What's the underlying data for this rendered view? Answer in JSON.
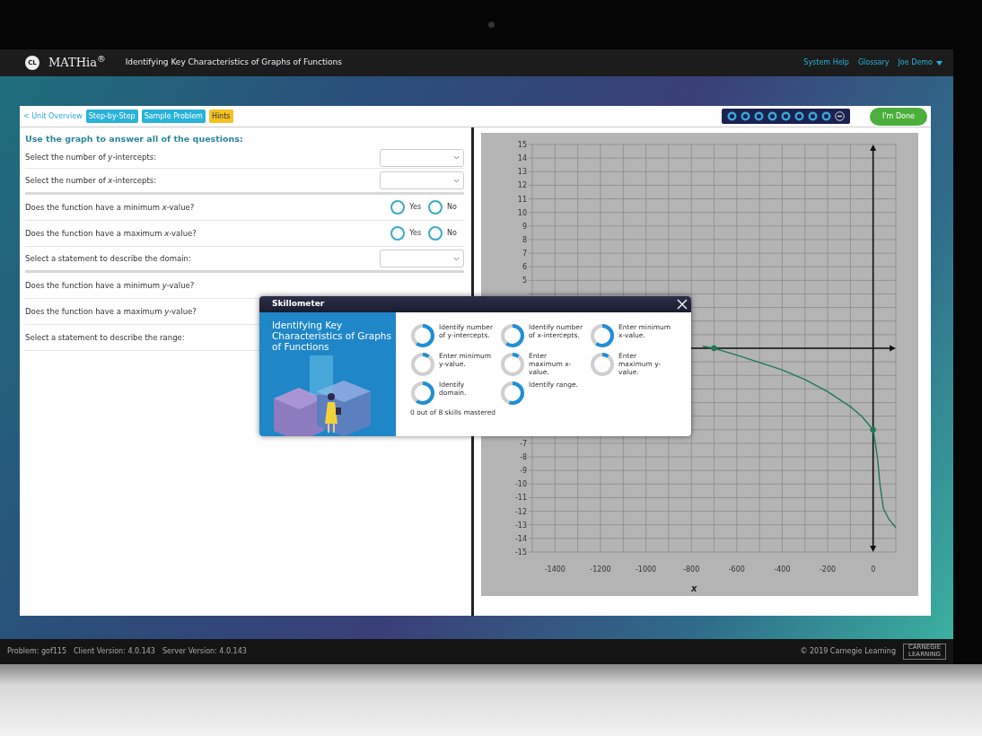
{
  "header": {
    "logo_mark": "CL",
    "app_name": "MATHia$^{®}$",
    "lesson_title": "Identifying Key Characteristics of Graphs of Functions",
    "links": [
      {
        "label": "System Help",
        "kind": "link"
      },
      {
        "label": "Glossary",
        "kind": "link"
      },
      {
        "label": "Joe Demo",
        "kind": "menu"
      }
    ]
  },
  "toolbar": {
    "back_link": "< Unit Overview",
    "tabs": [
      {
        "label": "Step-by-Step",
        "kind": "mode"
      },
      {
        "label": "Sample Problem",
        "kind": "mode"
      },
      {
        "label": "Hints",
        "kind": "hint"
      }
    ],
    "progress": [
      {
        "kind": "step"
      },
      {
        "kind": "step"
      },
      {
        "kind": "step"
      },
      {
        "kind": "step"
      },
      {
        "kind": "step"
      },
      {
        "kind": "step"
      },
      {
        "kind": "step"
      },
      {
        "kind": "step"
      },
      {
        "kind": "remove"
      }
    ],
    "done_button": "I'm Done"
  },
  "questions": {
    "heading": "Use the graph to answer all of the questions:",
    "rows": [
      {
        "text": "Select the number of *y*-intercepts:",
        "kind": "select",
        "divider_after": false
      },
      {
        "text": "Select the number of *x*-intercepts:",
        "kind": "select",
        "divider_after": true
      },
      {
        "text": "Does the function have a minimum *x*-value?",
        "kind": "radio",
        "divider_after": false,
        "options": [
          {
            "label": "Yes",
            "selected": false
          },
          {
            "label": "No",
            "selected": false
          }
        ]
      },
      {
        "text": "Does the function have a maximum *x*-value?",
        "kind": "radio",
        "divider_after": false,
        "options": [
          {
            "label": "Yes",
            "selected": false
          },
          {
            "label": "No",
            "selected": false
          }
        ]
      },
      {
        "text": "Select a statement to describe the domain:",
        "kind": "select",
        "divider_after": true
      },
      {
        "text": "Does the function have a minimum *y*-value?",
        "kind": "plain",
        "divider_after": false
      },
      {
        "text": "Does the function have a maximum *y*-value?",
        "kind": "plain",
        "divider_after": false
      },
      {
        "text": "Select a statement to describe the range:",
        "kind": "plain",
        "divider_after": false
      }
    ]
  },
  "graph": {
    "chart_data": {
      "type": "line",
      "xlabel": "x",
      "grid": true,
      "x": [
        -750,
        -700,
        -600,
        -500,
        -400,
        -300,
        -200,
        -100,
        -50,
        0,
        10,
        20,
        30,
        45,
        70,
        100
      ],
      "series": [
        {
          "color": "#1f7a55",
          "values": [
            0.15,
            0,
            -0.5,
            -1.05,
            -1.6,
            -2.3,
            -3.2,
            -4.3,
            -5,
            -6,
            -7,
            -8.2,
            -10,
            -11.8,
            -12.6,
            -13.2
          ]
        }
      ],
      "xlim": [
        -1500,
        100
      ],
      "ylim": [
        -15,
        15
      ],
      "xticks": [
        -1400,
        -1200,
        -1000,
        -800,
        -600,
        -400,
        -200,
        0
      ],
      "yticks": [
        -15,
        -14,
        -13,
        -12,
        -11,
        -10,
        -9,
        -8,
        -7,
        5,
        6,
        7,
        8,
        9,
        10,
        11,
        12,
        13,
        14,
        15
      ]
    }
  },
  "skillometer": {
    "title": "Skillometer",
    "heading": "Identifying Key Characteristics of Graphs of Functions",
    "skills": [
      {
        "label": "Identify number of y-intercepts.",
        "level": 0.6
      },
      {
        "label": "Identify number of x-intercepts.",
        "level": 0.6
      },
      {
        "label": "Enter minimum x-value.",
        "level": 0.6
      },
      {
        "label": "Enter minimum y-value.",
        "level": 0.1
      },
      {
        "label": "Enter maximum x-value.",
        "level": 0.1
      },
      {
        "label": "Enter maximum y-value.",
        "level": 0.1
      },
      {
        "label": "Identify domain.",
        "level": 0.6
      },
      {
        "label": "Identify range.",
        "level": 0.55
      }
    ],
    "summary": "0 out of 8 skills mastered"
  },
  "footer": {
    "problem": "Problem: gof115",
    "client_version": "Client Version: 4.0.143",
    "server_version": "Server Version: 4.0.143",
    "copyright": "© 2019 Carnegie Learning",
    "logo_text": "CARNEGIE LEARNING"
  }
}
